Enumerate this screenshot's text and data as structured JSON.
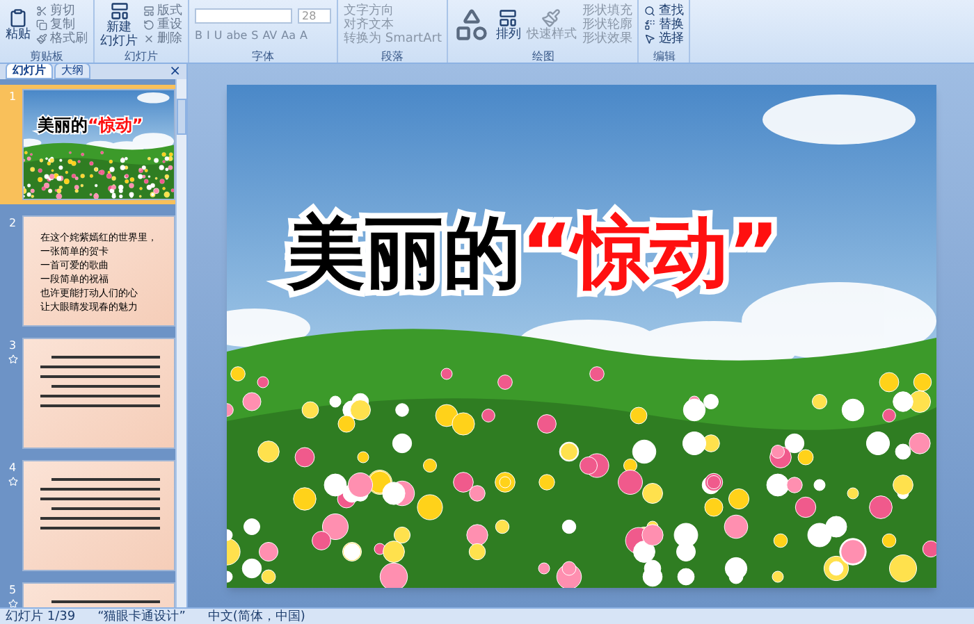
{
  "ribbon": {
    "groups": [
      {
        "label": "剪贴板",
        "kind": "clipboard",
        "big": [
          "粘贴"
        ],
        "small": [
          "剪切",
          "复制",
          "格式刷"
        ]
      },
      {
        "label": "幻灯片",
        "kind": "slides",
        "big": [
          "新建",
          "幻灯片"
        ],
        "small": [
          "版式",
          "重设",
          "删除"
        ]
      },
      {
        "label": "字体",
        "kind": "font",
        "size": "28",
        "buttons": [
          "B",
          "I",
          "U",
          "abe",
          "S",
          "AV",
          "Aa",
          "A"
        ]
      },
      {
        "label": "段落",
        "kind": "paragraph",
        "small": [
          "文字方向",
          "对齐文本",
          "转换为 SmartArt"
        ]
      },
      {
        "label": "绘图",
        "kind": "drawing",
        "big": "排列",
        "big2": "快速样式",
        "small": [
          "形状填充",
          "形状轮廓",
          "形状效果"
        ]
      },
      {
        "label": "编辑",
        "kind": "editing",
        "small": [
          "查找",
          "替换",
          "选择"
        ]
      }
    ]
  },
  "panel": {
    "tabs": [
      {
        "label": "幻灯片",
        "selected": true
      },
      {
        "label": "大纲",
        "selected": false
      }
    ],
    "close": "×",
    "slides": [
      {
        "number": "1",
        "selected": true,
        "kind": "title",
        "title": [
          {
            "text": "美丽的",
            "color": "#000000"
          },
          {
            "text": "“惊动”",
            "color": "#ff1010"
          }
        ]
      },
      {
        "number": "2",
        "selected": false,
        "kind": "text",
        "lines": [
          "在这个姹紫嫣红的世界里，",
          "一张简单的贺卡",
          "一首可爱的歌曲",
          "一段简单的祝福",
          "也许更能打动人们的心",
          "让大眼睛发现春的魅力"
        ]
      },
      {
        "number": "3",
        "selected": false,
        "kind": "text"
      },
      {
        "number": "4",
        "selected": false,
        "kind": "text"
      },
      {
        "number": "5",
        "selected": false,
        "kind": "text"
      }
    ]
  },
  "slide": {
    "title": [
      {
        "text": "美丽的",
        "color": "#000000"
      },
      {
        "text": "“惊动”",
        "color": "#ff1010"
      }
    ]
  },
  "status_bar": {
    "slide": "幻灯片 1/39",
    "theme": "“猫眼卡通设计”",
    "language": "中文(简体，中国)"
  }
}
